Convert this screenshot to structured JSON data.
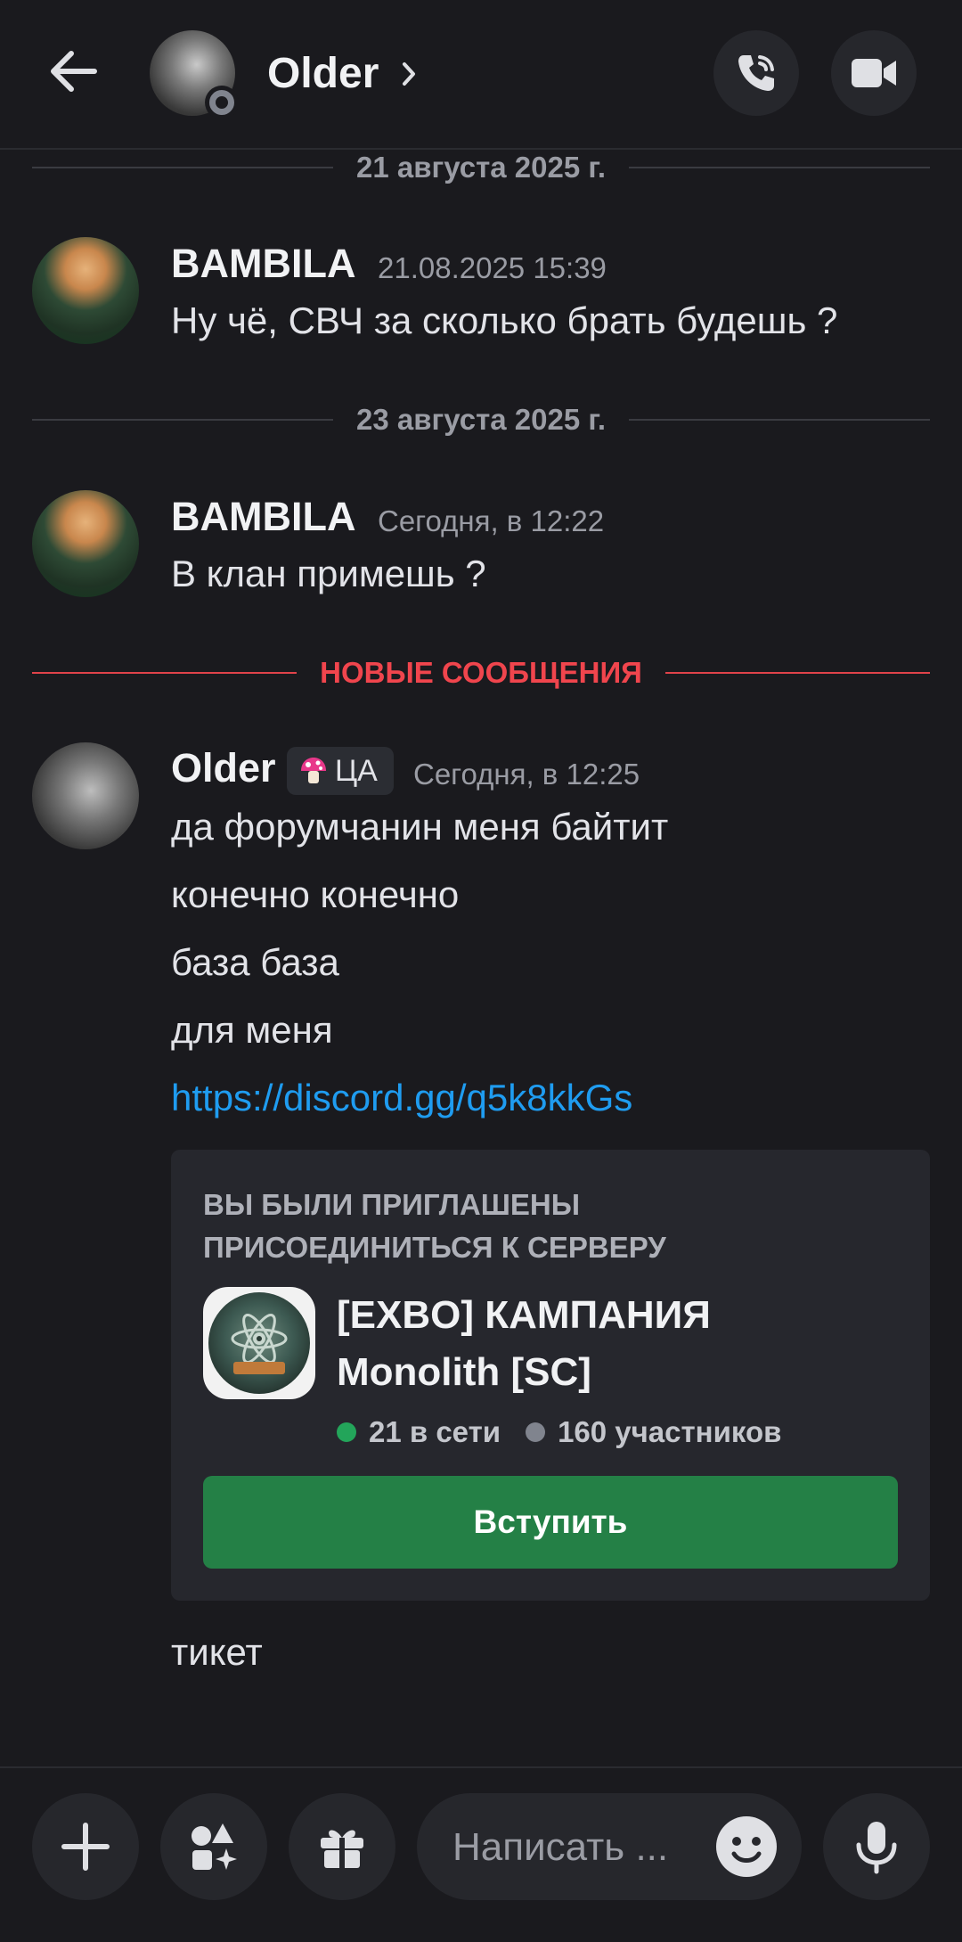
{
  "header": {
    "back_icon": "arrow-left-icon",
    "title": "Older",
    "chevron_icon": "chevron-right-icon",
    "call_icon": "phone-call-icon",
    "video_icon": "video-camera-icon"
  },
  "dividers": {
    "date1": "21 августа 2025 г.",
    "date2": "23 августа 2025 г.",
    "new_messages": "НОВЫЕ СООБЩЕНИЯ"
  },
  "messages": [
    {
      "author": "BAMBILA",
      "time": "21.08.2025 15:39",
      "lines": [
        "Ну чё, СВЧ за сколько брать будешь ?"
      ]
    },
    {
      "author": "BAMBILA",
      "time": "Сегодня, в 12:22",
      "lines": [
        "В клан примешь ?"
      ]
    },
    {
      "author": "Older",
      "role_tag": "ЦА",
      "time": "Сегодня, в 12:25",
      "lines": [
        "да форумчанин меня байтит",
        "конечно конечно",
        "база база",
        "для меня",
        "https://discord.gg/q5k8kkGs"
      ],
      "after_invite": "тикет"
    }
  ],
  "invite": {
    "heading_line1": "ВЫ БЫЛИ ПРИГЛАШЕНЫ",
    "heading_line2": "ПРИСОЕДИНИТЬСЯ К СЕРВЕРУ",
    "server_name_line1": "[EXBO] КАМПАНИЯ",
    "server_name_line2": "Monolith [SC]",
    "online": "21 в сети",
    "members": "160 участников",
    "join_label": "Вступить",
    "online_color": "#23a55a",
    "button_color": "#248046"
  },
  "composer": {
    "placeholder": "Написать ...",
    "icons": [
      "plus-icon",
      "apps-icon",
      "gift-icon",
      "emoji-icon",
      "microphone-icon"
    ]
  },
  "colors": {
    "background": "#1a1a1e",
    "new_messages": "#f0454d",
    "link": "#1f9cf0"
  }
}
